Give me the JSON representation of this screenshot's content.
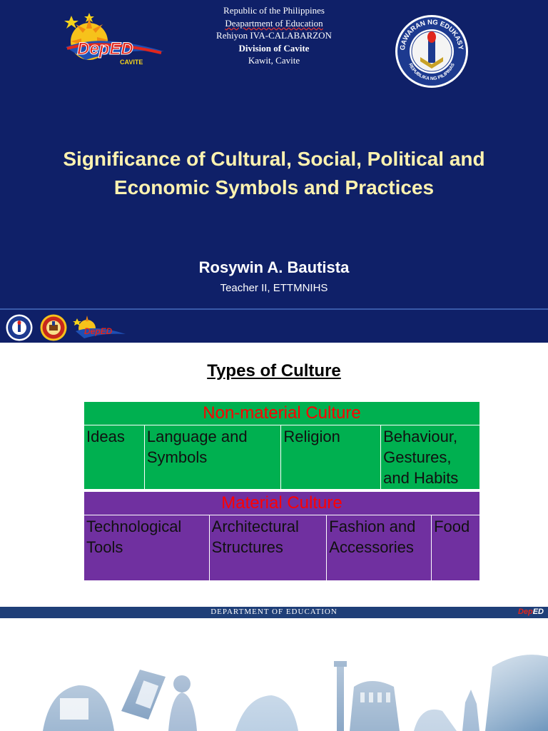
{
  "slide1": {
    "letterhead": {
      "line1": "Republic of the Philippines",
      "line2": "Deapartment of Education",
      "line3": "Rehiyon IVA-CALABARZON",
      "line4": "Division of Cavite",
      "line5": "Kawit, Cavite"
    },
    "deped_logo_text": "DepED",
    "deped_logo_sub": "CAVITE",
    "seal_text_top": "KAGAWARAN NG EDUKASYON",
    "seal_text_bottom": "REPUBLIKA NG PILIPINAS",
    "title_line1": "Significance of Cultural, Social, Political and",
    "title_line2": "Economic Symbols and Practices",
    "author": "Rosywin A. Bautista",
    "author_role": "Teacher II, ETTMNIHS"
  },
  "slide2": {
    "title": "Types of Culture",
    "non_material": {
      "heading": "Non-material Culture",
      "cells": [
        "Ideas",
        "Language and Symbols",
        "Religion",
        "Behaviour, Gestures, and Habits"
      ]
    },
    "material": {
      "heading": "Material Culture",
      "cells": [
        "Technological Tools",
        "Architectural Structures",
        "Fashion and Accessories",
        "Food"
      ]
    },
    "footer": "DEPARTMENT OF EDUCATION",
    "footer_logo_a": "Dep",
    "footer_logo_b": "ED"
  },
  "colors": {
    "navy": "#0f2068",
    "title_yellow": "#fdf2b0",
    "green": "#00b050",
    "purple": "#7030a0",
    "heading_red": "#ff0000"
  }
}
